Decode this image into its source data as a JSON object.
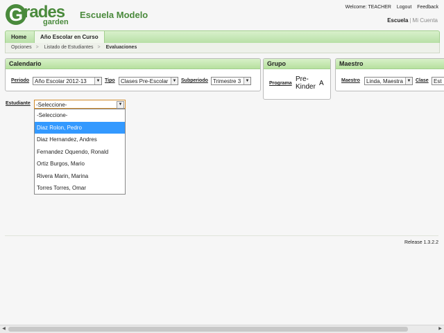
{
  "header": {
    "logo_letter": "G",
    "logo_word": "rades",
    "logo_sub": "garden",
    "school_name": "Escuela Modelo",
    "welcome": "Welcome: TEACHER",
    "logout": "Logout",
    "feedback": "Feedback",
    "escuela_link": "Escuela",
    "separator": "|",
    "mi_cuenta_link": "Mi Cuenta"
  },
  "tabs": [
    {
      "label": "Home"
    },
    {
      "label": "Año Escolar en Curso"
    }
  ],
  "breadcrumb": {
    "items": [
      "Opciones",
      "Listado de Estudiantes",
      "Evaluaciones"
    ],
    "sep": ">"
  },
  "calendario": {
    "title": "Calendario",
    "periodo_label": "Periodo",
    "periodo_value": "Año Escolar 2012-13",
    "tipo_label": "Tipo",
    "tipo_value": "Clases Pre-Escolar",
    "subperiodo_label": "Subperiodo",
    "subperiodo_value": "Trimestre 3"
  },
  "grupo": {
    "title": "Grupo",
    "programa_label": "Programa",
    "programa_value": "Pre-Kinder",
    "section": "A"
  },
  "maestro": {
    "title": "Maestro",
    "maestro_label": "Maestro",
    "maestro_value": "Linda, Maestra",
    "clase_label": "Clase",
    "clase_value": "Est"
  },
  "estudiante": {
    "label": "Estudiante",
    "selected": "-Seleccione-",
    "options": [
      "-Seleccione-",
      "Diaz Rolon, Pedro",
      "Diaz Hernandez, Andres",
      "Fernandez Oquendo, Ronald",
      "Ortiz Burgos, Mario",
      "Rivera Marin, Marina",
      "Torres Torres, Omar"
    ],
    "highlighted_index": 1
  },
  "footer": {
    "release": "Release 1.3.2.2"
  },
  "icons": {
    "dropdown_arrow": "chevron-down-icon",
    "scroll_left": "arrow-left-icon",
    "scroll_right": "arrow-right-icon"
  },
  "colors": {
    "brand_green": "#4a8a3c",
    "highlight_blue": "#3399ff",
    "tab_green": "#b8e0a6"
  }
}
